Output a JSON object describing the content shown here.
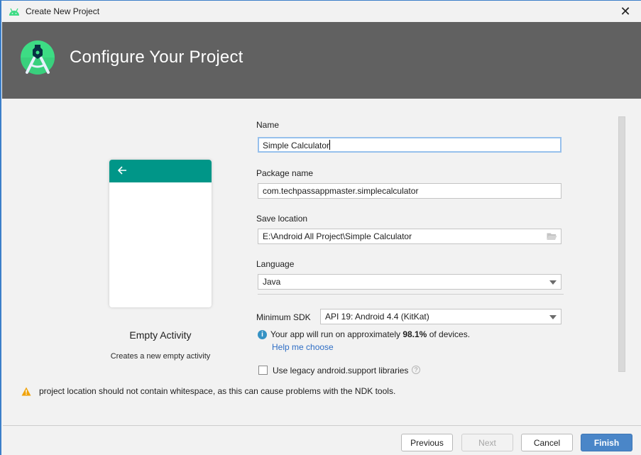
{
  "window": {
    "title": "Create New Project",
    "close_glyph": "✕"
  },
  "header": {
    "heading": "Configure Your Project"
  },
  "template_preview": {
    "name": "Empty Activity",
    "description": "Creates a new empty activity",
    "toolbar_color": "#009688"
  },
  "form": {
    "name": {
      "label": "Name",
      "value": "Simple Calculator"
    },
    "package_name": {
      "label": "Package name",
      "value": "com.techpassappmaster.simplecalculator"
    },
    "save_location": {
      "label": "Save location",
      "value": "E:\\Android All Project\\Simple Calculator"
    },
    "language": {
      "label": "Language",
      "selected": "Java"
    },
    "minimum_sdk": {
      "label": "Minimum SDK",
      "selected": "API 19: Android 4.4 (KitKat)"
    },
    "device_coverage": {
      "prefix": "Your app will run on approximately ",
      "percent": "98.1%",
      "suffix": " of devices."
    },
    "help_link": "Help me choose",
    "legacy_support": {
      "label": "Use legacy android.support libraries",
      "checked": false
    }
  },
  "warning": {
    "text": "project location should not contain whitespace, as this can cause problems with the NDK tools."
  },
  "buttons": {
    "previous": "Previous",
    "next": "Next",
    "cancel": "Cancel",
    "finish": "Finish"
  },
  "colors": {
    "header_bg": "#616161",
    "accent": "#4a86c8",
    "link": "#2f6ec5",
    "warning": "#f0a30a"
  }
}
